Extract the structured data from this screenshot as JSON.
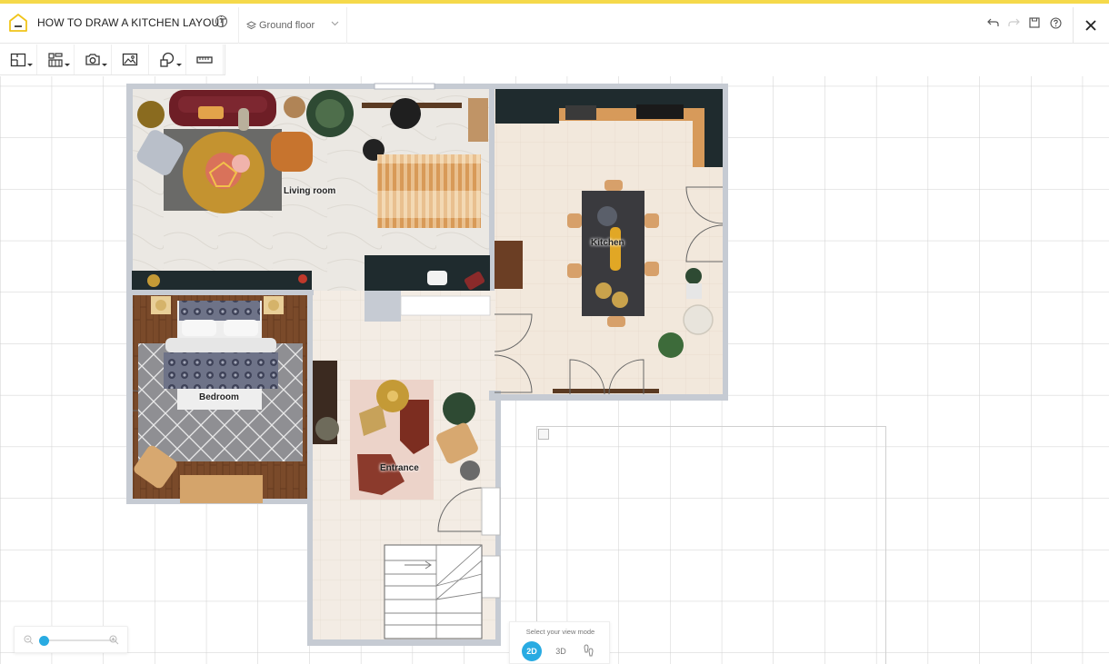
{
  "header": {
    "title": "HOW TO DRAW A KITCHEN LAYOUT",
    "info_glyph": "i",
    "floor": "Ground floor",
    "accent": "#f5d94a"
  },
  "toolbar": {
    "tools": [
      "floor-plan-icon",
      "furniture-icon",
      "camera-icon",
      "image-icon",
      "shapes-icon",
      "ruler-icon"
    ]
  },
  "rooms": {
    "living": "Living room",
    "kitchen": "Kitchen",
    "bedroom": "Bedroom",
    "entrance": "Entrance"
  },
  "zoom": {
    "level": 0.2,
    "accent": "#29abe2"
  },
  "view_mode": {
    "title": "Select your view mode",
    "options": [
      "2D",
      "3D"
    ],
    "selected": "2D"
  }
}
